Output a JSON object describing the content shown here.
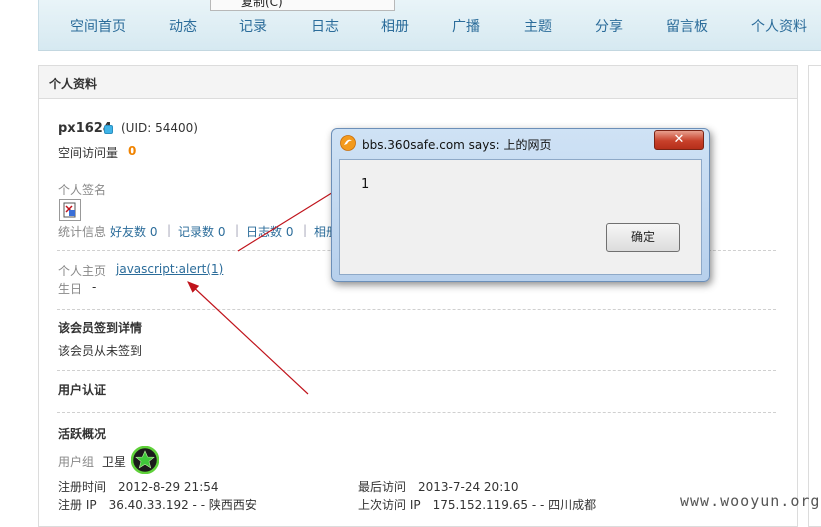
{
  "nav": {
    "items": [
      "空间首页",
      "动态",
      "记录",
      "日志",
      "相册",
      "广播",
      "主题",
      "分享",
      "留言板",
      "个人资料"
    ]
  },
  "context_menu": {
    "partial_item": "复制(C)"
  },
  "panel": {
    "title": "个人资料"
  },
  "profile": {
    "username": "px1624",
    "uid": "(UID: 54400)",
    "visits_label": "空间访问量",
    "visits_value": "0",
    "signature_label": "个人签名",
    "stats_label": "统计信息",
    "friends": "好友数 0",
    "records": "记录数 0",
    "logs": "日志数 0",
    "albums_partial": "相册",
    "homepage_label": "个人主页",
    "homepage_value": "javascript:alert(1)",
    "birthday_label": "生日",
    "birthday_value": "-",
    "checkin_title": "该会员签到详情",
    "checkin_text": "该会员从未签到",
    "verify_title": "用户认证",
    "activity_title": "活跃概况",
    "group_label": "用户组",
    "group_value": "卫星",
    "reg_time": "注册时间　2012-8-29 21:54",
    "last_visit": "最后访问　2013-7-24 20:10",
    "reg_ip": "注册 IP　36.40.33.192 - - 陕西西安",
    "last_ip": "上次访问 IP　175.152.119.65 - - 四川成都"
  },
  "dialog": {
    "title": "bbs.360safe.com says: 上的网页",
    "message": "1",
    "ok_label": "确定",
    "close_label": "✕"
  },
  "watermark": "www.wooyun.org",
  "colors": {
    "link": "#2b6c9a",
    "accent": "#f08300",
    "arrow": "#c0141c"
  }
}
